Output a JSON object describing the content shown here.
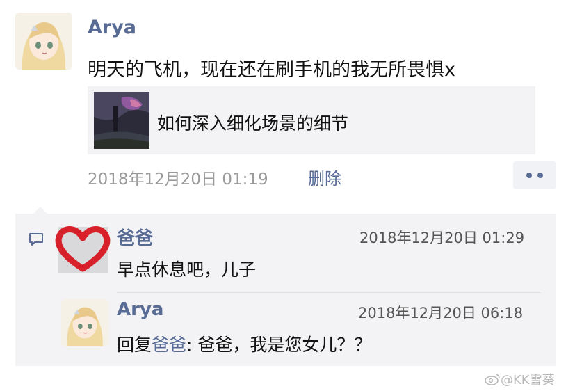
{
  "post": {
    "author": "Arya",
    "text": "明天的飞机，现在还在刷手机的我无所畏惧x",
    "share_title": "如何深入细化场景的细节",
    "timestamp": "2018年12月20日 01:19",
    "delete_label": "删除",
    "more_icon": "ellipsis-icon"
  },
  "comments": [
    {
      "author": "爸爸",
      "time": "2018年12月20日 01:29",
      "text": "早点休息吧，儿子"
    },
    {
      "author": "Arya",
      "time": "2018年12月20日 06:18",
      "reply_prefix": "回复",
      "reply_to": "爸爸",
      "reply_sep": ": ",
      "text": "爸爸，我是您女儿？？"
    }
  ],
  "watermark": "@KK雪葵",
  "colors": {
    "link": "#576b95",
    "panel": "#f3f3f5",
    "heart": "#d8202a"
  }
}
